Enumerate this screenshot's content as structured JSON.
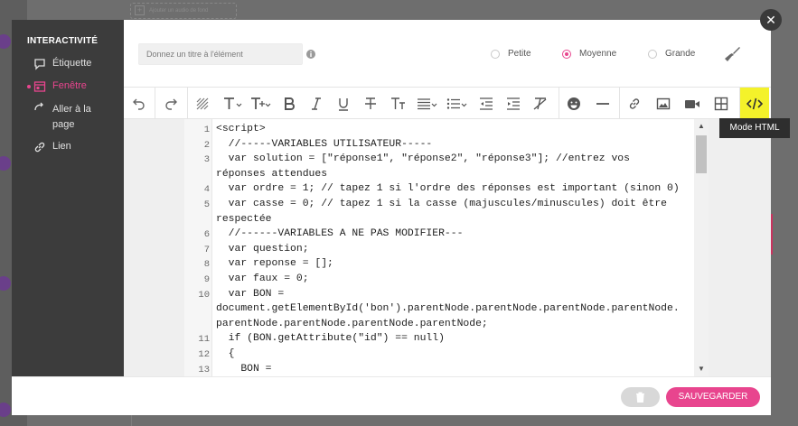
{
  "background": {
    "audio_placeholder": "Ajouter un audio de fond"
  },
  "sidebar": {
    "title": "INTERACTIVITÉ",
    "items": [
      {
        "label": "Étiquette",
        "icon": "comment-icon",
        "active": false
      },
      {
        "label": "Fenêtre",
        "icon": "window-icon",
        "active": true
      },
      {
        "label": "Aller à la page",
        "icon": "page-arrow-icon",
        "active": false
      },
      {
        "label": "Lien",
        "icon": "link-icon",
        "active": false
      }
    ]
  },
  "header": {
    "title_placeholder": "Donnez un titre à l'élément",
    "sizes": [
      {
        "label": "Petite",
        "selected": false
      },
      {
        "label": "Moyenne",
        "selected": true
      },
      {
        "label": "Grande",
        "selected": false
      }
    ]
  },
  "toolbar": {
    "buttons": [
      "undo-icon",
      "redo-icon",
      "clear-format-icon",
      "font-family-icon",
      "font-size-icon",
      "bold-icon",
      "italic-icon",
      "underline-icon",
      "strikethrough-icon",
      "text-transform-icon",
      "align-icon",
      "list-icon",
      "outdent-icon",
      "indent-icon",
      "remove-format-icon",
      "emoji-icon",
      "horizontal-rule-icon",
      "link-icon",
      "image-icon",
      "video-icon",
      "table-icon",
      "code-view-icon"
    ],
    "tooltip": "Mode HTML"
  },
  "editor": {
    "lines": [
      {
        "n": "1",
        "text": "<script>"
      },
      {
        "n": "2",
        "text": "  //-----VARIABLES UTILISATEUR-----"
      },
      {
        "n": "3",
        "text": "  var solution = [\"réponse1\", \"réponse2\", \"réponse3\"]; //entrez vos"
      },
      {
        "n": "",
        "text": "réponses attendues"
      },
      {
        "n": "4",
        "text": "  var ordre = 1; // tapez 1 si l'ordre des réponses est important (sinon 0)"
      },
      {
        "n": "5",
        "text": "  var casse = 0; // tapez 1 si la casse (majuscules/minuscules) doit être"
      },
      {
        "n": "",
        "text": "respectée"
      },
      {
        "n": "6",
        "text": "  //------VARIABLES A NE PAS MODIFIER---"
      },
      {
        "n": "7",
        "text": "  var question;"
      },
      {
        "n": "8",
        "text": "  var reponse = [];"
      },
      {
        "n": "9",
        "text": "  var faux = 0;"
      },
      {
        "n": "10",
        "text": "  var BON ="
      },
      {
        "n": "",
        "text": "document.getElementById('bon').parentNode.parentNode.parentNode.parentNode."
      },
      {
        "n": "",
        "text": "parentNode.parentNode.parentNode.parentNode;"
      },
      {
        "n": "11",
        "text": "  if (BON.getAttribute(\"id\") == null)"
      },
      {
        "n": "12",
        "text": "  {"
      },
      {
        "n": "13",
        "text": "    BON ="
      }
    ]
  },
  "footer": {
    "save_label": "SAUVEGARDER",
    "delete_icon": "trash-icon"
  },
  "colors": {
    "accent": "#e8458e",
    "highlight": "#f4f22a",
    "sidebar_bg": "#3c3c3c"
  }
}
